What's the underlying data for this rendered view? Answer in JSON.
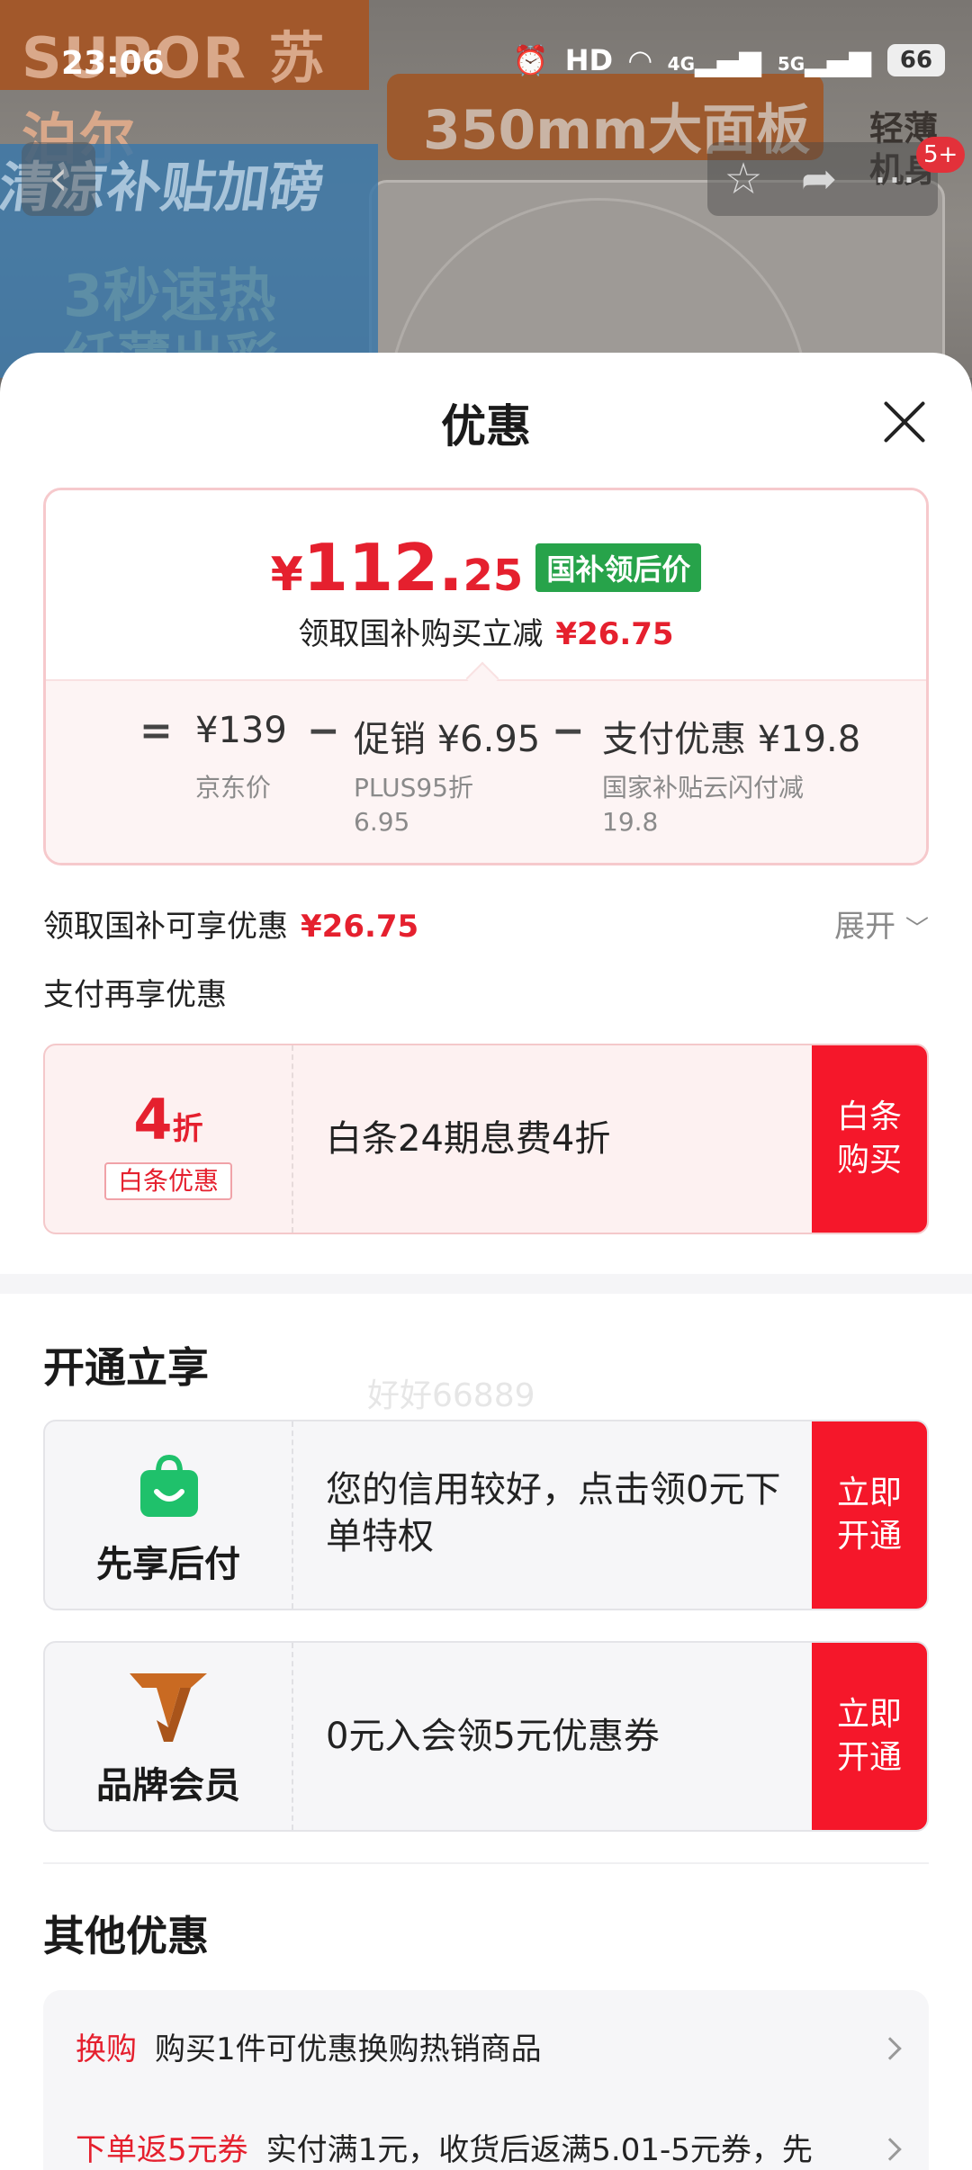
{
  "status_bar": {
    "time": "23:06",
    "hd": "HD",
    "net1": "4G",
    "net2": "5G",
    "battery": "66"
  },
  "banner": {
    "brand": "SUPOR 苏泊尔",
    "headline_pill": "350mm大面板",
    "promo_line1": "清凉补贴加磅",
    "promo_line2": "3秒速热",
    "promo_line3": "纤薄出彩",
    "corner_badge": "轻薄机身",
    "notification_count": "5+"
  },
  "nav": {
    "back_icon": "chevron-left-icon",
    "favorite_icon": "star-icon",
    "share_icon": "share-icon"
  },
  "sheet": {
    "title": "优惠",
    "price": {
      "yen": "¥",
      "integer": "112.",
      "decimal": "25",
      "tag": "国补领后价",
      "sub_label": "领取国补购买立减",
      "sub_value": "¥26.75"
    },
    "calc": [
      {
        "op": "=",
        "value": "¥139",
        "label_1": "京东价",
        "label_2": ""
      },
      {
        "op": "−",
        "value": "促销 ¥6.95",
        "label_1": "PLUS95折",
        "label_2": "6.95"
      },
      {
        "op": "−",
        "value": "支付优惠 ¥19.8",
        "label_1": "国家补贴云闪付减",
        "label_2": "19.8"
      }
    ],
    "subsidy_row": {
      "label": "领取国补可享优惠",
      "value": "¥26.75",
      "expand": "展开"
    },
    "pay_again": "支付再享优惠",
    "baitiao": {
      "discount_num": "4",
      "discount_unit": "折",
      "tag": "白条优惠",
      "desc": "白条24期息费4折",
      "button": "白条购买"
    },
    "open_section": {
      "title": "开通立享",
      "items": [
        {
          "name": "先享后付",
          "desc": "您的信用较好，点击领0元下单特权",
          "button": "立即开通",
          "icon": "shopping-bag-icon"
        },
        {
          "name": "品牌会员",
          "desc": "0元入会领5元优惠券",
          "button": "立即开通",
          "icon": "brand-v-logo-icon"
        }
      ]
    },
    "other_section": {
      "title": "其他优惠",
      "rows": [
        {
          "tag": "换购",
          "text": "购买1件可优惠换购热销商品"
        },
        {
          "tag": "下单返5元券",
          "text": "实付满1元，收货后返满5.01-5元券，先"
        }
      ]
    },
    "watermark": "好好66889"
  },
  "colors": {
    "accent_red": "#e5202e",
    "button_red": "#f5172a",
    "tag_green": "#27a34a"
  }
}
